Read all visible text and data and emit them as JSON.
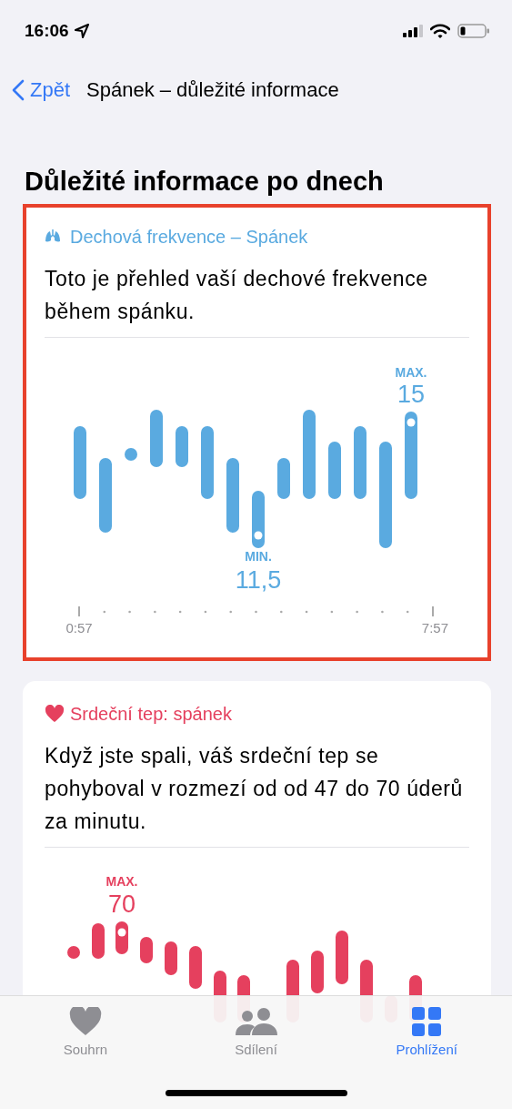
{
  "status_bar": {
    "time": "16:06"
  },
  "nav": {
    "back": "Zpět",
    "title": "Spánek – důležité informace"
  },
  "heading": "Důležité informace po dnech",
  "cards": [
    {
      "kind": "respiratory",
      "highlighted": true,
      "title": "Dechová frekvence – Spánek",
      "text": "Toto je přehled vaší dechové frekvence během spánku.",
      "max_label": "MAX.",
      "max_value": "15",
      "min_label": "MIN.",
      "min_value": "11,5",
      "axis_start": "0:57",
      "axis_end": "7:57"
    },
    {
      "kind": "heart",
      "highlighted": false,
      "title": "Srdeční tep: spánek",
      "text": "Když jste spali, váš srdeční tep se pohyboval v rozmezí od od 47 do 70 úderů za minutu.",
      "max_label": "MAX.",
      "max_value": "70"
    }
  ],
  "tab_bar": [
    {
      "label": "Souhrn",
      "selected": false
    },
    {
      "label": "Sdílení",
      "selected": false
    },
    {
      "label": "Prohlížení",
      "selected": true
    }
  ]
}
